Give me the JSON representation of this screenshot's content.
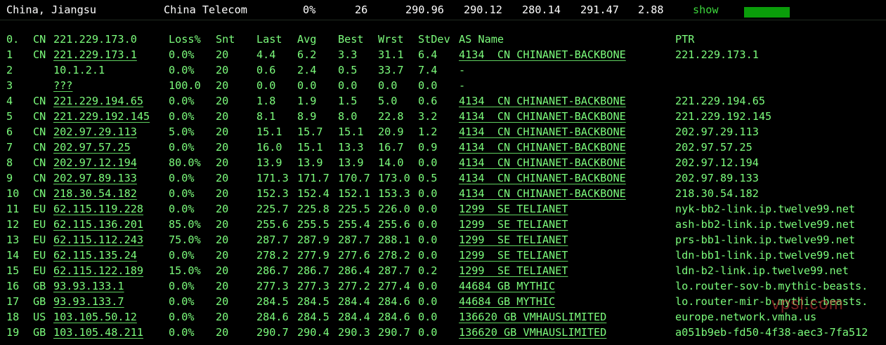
{
  "header": {
    "location": "China, Jiangsu",
    "isp": "China Telecom",
    "loss": "0%",
    "sent": "26",
    "last": "290.96",
    "avg": "290.12",
    "best": "280.14",
    "worst": "291.47",
    "stdev": "2.88",
    "show_label": "show",
    "bar_color": "#0A9D0A"
  },
  "columns": {
    "idx": "0.",
    "cc": "CN",
    "host": "221.229.173.0",
    "loss": "Loss%",
    "snt": "Snt",
    "last": "Last",
    "avg": "Avg",
    "best": "Best",
    "wrst": "Wrst",
    "stdev": "StDev",
    "as": "AS Name",
    "ptr": "PTR"
  },
  "hops": [
    {
      "idx": "1",
      "cc": "CN",
      "host": "221.229.173.1",
      "loss": "0.0%",
      "snt": "20",
      "last": "4.4",
      "avg": "6.2",
      "best": "3.3",
      "wrst": "31.1",
      "stdev": "6.4",
      "as": "4134  CN CHINANET-BACKBONE",
      "ptr": "221.229.173.1"
    },
    {
      "idx": "2",
      "cc": "",
      "host": "10.1.2.1",
      "loss": "0.0%",
      "snt": "20",
      "last": "0.6",
      "avg": "2.4",
      "best": "0.5",
      "wrst": "33.7",
      "stdev": "7.4",
      "as": "-",
      "ptr": ""
    },
    {
      "idx": "3",
      "cc": "",
      "host": "???",
      "loss": "100.0",
      "snt": "20",
      "last": "0.0",
      "avg": "0.0",
      "best": "0.0",
      "wrst": "0.0",
      "stdev": "0.0",
      "as": "-",
      "ptr": ""
    },
    {
      "idx": "4",
      "cc": "CN",
      "host": "221.229.194.65",
      "loss": "0.0%",
      "snt": "20",
      "last": "1.8",
      "avg": "1.9",
      "best": "1.5",
      "wrst": "5.0",
      "stdev": "0.6",
      "as": "4134  CN CHINANET-BACKBONE",
      "ptr": "221.229.194.65"
    },
    {
      "idx": "5",
      "cc": "CN",
      "host": "221.229.192.145",
      "loss": "0.0%",
      "snt": "20",
      "last": "8.1",
      "avg": "8.9",
      "best": "8.0",
      "wrst": "22.8",
      "stdev": "3.2",
      "as": "4134  CN CHINANET-BACKBONE",
      "ptr": "221.229.192.145"
    },
    {
      "idx": "6",
      "cc": "CN",
      "host": "202.97.29.113",
      "loss": "5.0%",
      "snt": "20",
      "last": "15.1",
      "avg": "15.7",
      "best": "15.1",
      "wrst": "20.9",
      "stdev": "1.2",
      "as": "4134  CN CHINANET-BACKBONE",
      "ptr": "202.97.29.113"
    },
    {
      "idx": "7",
      "cc": "CN",
      "host": "202.97.57.25",
      "loss": "0.0%",
      "snt": "20",
      "last": "16.0",
      "avg": "15.1",
      "best": "13.3",
      "wrst": "16.7",
      "stdev": "0.9",
      "as": "4134  CN CHINANET-BACKBONE",
      "ptr": "202.97.57.25"
    },
    {
      "idx": "8",
      "cc": "CN",
      "host": "202.97.12.194",
      "loss": "80.0%",
      "snt": "20",
      "last": "13.9",
      "avg": "13.9",
      "best": "13.9",
      "wrst": "14.0",
      "stdev": "0.0",
      "as": "4134  CN CHINANET-BACKBONE",
      "ptr": "202.97.12.194"
    },
    {
      "idx": "9",
      "cc": "CN",
      "host": "202.97.89.133",
      "loss": "0.0%",
      "snt": "20",
      "last": "171.3",
      "avg": "171.7",
      "best": "170.7",
      "wrst": "173.0",
      "stdev": "0.5",
      "as": "4134  CN CHINANET-BACKBONE",
      "ptr": "202.97.89.133"
    },
    {
      "idx": "10",
      "cc": "CN",
      "host": "218.30.54.182",
      "loss": "0.0%",
      "snt": "20",
      "last": "152.3",
      "avg": "152.4",
      "best": "152.1",
      "wrst": "153.3",
      "stdev": "0.0",
      "as": "4134  CN CHINANET-BACKBONE",
      "ptr": "218.30.54.182"
    },
    {
      "idx": "11",
      "cc": "EU",
      "host": "62.115.119.228",
      "loss": "0.0%",
      "snt": "20",
      "last": "225.7",
      "avg": "225.8",
      "best": "225.5",
      "wrst": "226.0",
      "stdev": "0.0",
      "as": "1299  SE TELIANET",
      "ptr": "nyk-bb2-link.ip.twelve99.net"
    },
    {
      "idx": "12",
      "cc": "EU",
      "host": "62.115.136.201",
      "loss": "85.0%",
      "snt": "20",
      "last": "255.6",
      "avg": "255.5",
      "best": "255.4",
      "wrst": "255.6",
      "stdev": "0.0",
      "as": "1299  SE TELIANET",
      "ptr": "ash-bb2-link.ip.twelve99.net"
    },
    {
      "idx": "13",
      "cc": "EU",
      "host": "62.115.112.243",
      "loss": "75.0%",
      "snt": "20",
      "last": "287.7",
      "avg": "287.9",
      "best": "287.7",
      "wrst": "288.1",
      "stdev": "0.0",
      "as": "1299  SE TELIANET",
      "ptr": "prs-bb1-link.ip.twelve99.net"
    },
    {
      "idx": "14",
      "cc": "EU",
      "host": "62.115.135.24",
      "loss": "0.0%",
      "snt": "20",
      "last": "278.2",
      "avg": "277.9",
      "best": "277.6",
      "wrst": "278.2",
      "stdev": "0.0",
      "as": "1299  SE TELIANET",
      "ptr": "ldn-bb1-link.ip.twelve99.net"
    },
    {
      "idx": "15",
      "cc": "EU",
      "host": "62.115.122.189",
      "loss": "15.0%",
      "snt": "20",
      "last": "286.7",
      "avg": "286.7",
      "best": "286.4",
      "wrst": "287.7",
      "stdev": "0.2",
      "as": "1299  SE TELIANET",
      "ptr": "ldn-b2-link.ip.twelve99.net"
    },
    {
      "idx": "16",
      "cc": "GB",
      "host": "93.93.133.1",
      "loss": "0.0%",
      "snt": "20",
      "last": "277.3",
      "avg": "277.3",
      "best": "277.2",
      "wrst": "277.4",
      "stdev": "0.0",
      "as": "44684 GB MYTHIC",
      "ptr": "lo.router-sov-b.mythic-beasts."
    },
    {
      "idx": "17",
      "cc": "GB",
      "host": "93.93.133.7",
      "loss": "0.0%",
      "snt": "20",
      "last": "284.5",
      "avg": "284.5",
      "best": "284.4",
      "wrst": "284.6",
      "stdev": "0.0",
      "as": "44684 GB MYTHIC",
      "ptr": "lo.router-mir-b.mythic-beasts."
    },
    {
      "idx": "18",
      "cc": "US",
      "host": "103.105.50.12",
      "loss": "0.0%",
      "snt": "20",
      "last": "284.6",
      "avg": "284.5",
      "best": "284.4",
      "wrst": "284.6",
      "stdev": "0.0",
      "as": "136620 GB VMHAUSLIMITED",
      "ptr": "europe.network.vmha.us"
    },
    {
      "idx": "19",
      "cc": "GB",
      "host": "103.105.48.211",
      "loss": "0.0%",
      "snt": "20",
      "last": "290.7",
      "avg": "290.4",
      "best": "290.3",
      "wrst": "290.7",
      "stdev": "0.0",
      "as": "136620 GB VMHAUSLIMITED",
      "ptr": "a051b9eb-fd50-4f38-aec3-7fa512"
    }
  ],
  "watermark": "vpsl.com"
}
